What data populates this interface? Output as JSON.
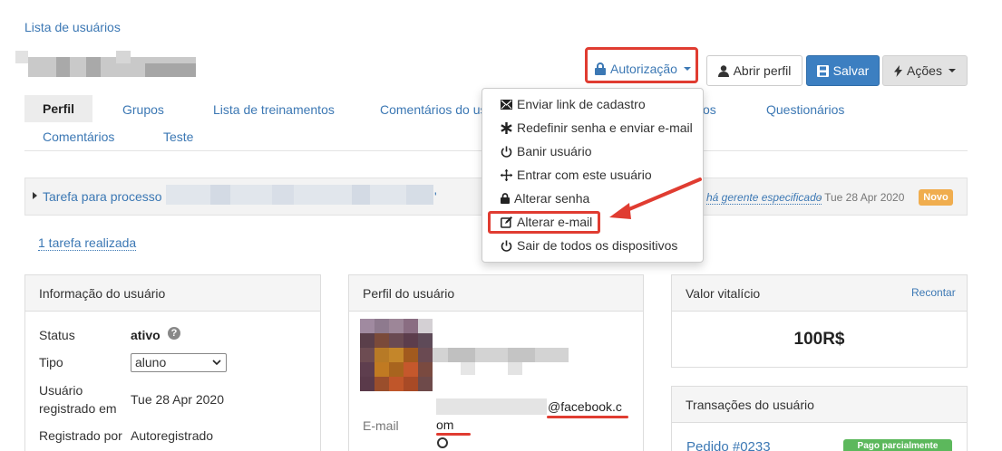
{
  "breadcrumb": {
    "label": "Lista de usuários"
  },
  "toolbar": {
    "autorizacao_label": "Autorização",
    "abrir_perfil_label": "Abrir perfil",
    "salvar_label": "Salvar",
    "acoes_label": "Ações"
  },
  "tabs": {
    "row1": [
      "Perfil",
      "Grupos",
      "Lista de treinamentos",
      "Comentários do us",
      "os",
      "Questionários"
    ],
    "row2": [
      "Comentários",
      "Teste"
    ]
  },
  "dropdown": {
    "items": [
      {
        "label": "Enviar link de cadastro",
        "icon": "envelope-icon"
      },
      {
        "label": "Redefinir senha e enviar e-mail",
        "icon": "asterisk-icon"
      },
      {
        "label": "Banir usuário",
        "icon": "power-icon"
      },
      {
        "label": "Entrar com este usuário",
        "icon": "move-icon"
      },
      {
        "label": "Alterar senha",
        "icon": "lock-icon"
      },
      {
        "label": "Alterar e-mail",
        "icon": "edit-icon"
      },
      {
        "label": "Sair de todos os dispositivos",
        "icon": "power-icon"
      }
    ]
  },
  "task": {
    "prefix": "Tarefa para processo '",
    "suffix": "'",
    "manager_text": "há gerente especificado",
    "date_text": " - Tue 28 Apr 2020",
    "badge": "Novo",
    "done_link": "1 tarefa realizada"
  },
  "user_info": {
    "title": "Informação do usuário",
    "status_label": "Status",
    "status_value": "ativo",
    "tipo_label": "Tipo",
    "tipo_value": "aluno",
    "registrado_label_line1": "Usuário",
    "registrado_label_line2": "registrado em",
    "registrado_value": "Tue 28 Apr 2020",
    "registrado_por_label": "Registrado por",
    "registrado_por_value": "Autoregistrado"
  },
  "profile": {
    "title": "Perfil do usuário",
    "email_label": "E-mail",
    "email_domain_part1": "@facebook.c",
    "email_domain_part2": "om"
  },
  "lifetime": {
    "title": "Valor vitalício",
    "recount_link": "Recontar",
    "value": "100R$"
  },
  "transactions": {
    "title": "Transações do usuário",
    "order_link": "Pedido #0233",
    "status_badge": "Pago parcialmente"
  },
  "colors": {
    "link": "#3c78b4",
    "primary": "#3c7fc1",
    "annotation_red": "#e03c31",
    "badge_orange": "#f0ad4e",
    "badge_green": "#5cb85c"
  }
}
